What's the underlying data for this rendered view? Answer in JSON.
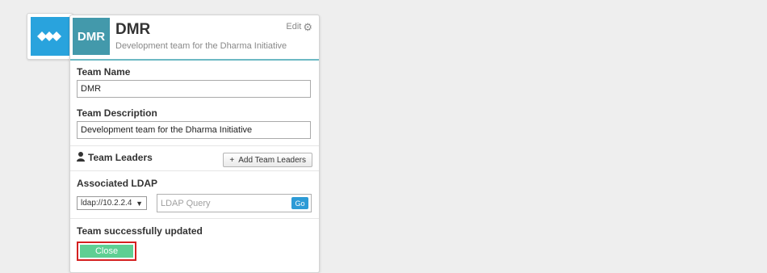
{
  "app": {
    "logo_icon": "chevron-arrows-logo-icon",
    "accent_color": "#29a3dd"
  },
  "team_card": {
    "avatar_text": "DMR",
    "title": "DMR",
    "subtitle": "Development team for the Dharma Initiative",
    "edit_label": "Edit",
    "edit_icon": "gear-icon"
  },
  "form": {
    "team_name_label": "Team Name",
    "team_name_value": "DMR",
    "team_description_label": "Team Description",
    "team_description_value": "Development team for the Dharma Initiative",
    "team_leaders_label": "Team Leaders",
    "add_team_leaders_label": "Add Team Leaders",
    "associated_ldap_label": "Associated LDAP",
    "ldap_server_selected": "ldap://10.2.2.4",
    "ldap_query_placeholder": "LDAP Query",
    "go_label": "Go"
  },
  "status": {
    "message": "Team successfully updated",
    "close_label": "Close",
    "close_color": "#5ecf93",
    "highlight_color": "#d42020"
  }
}
